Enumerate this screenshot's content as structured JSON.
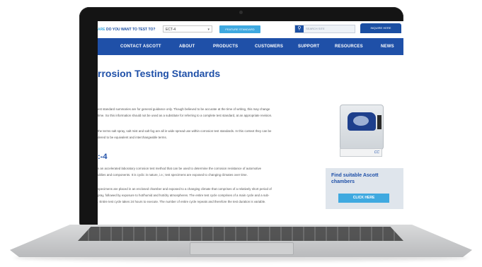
{
  "topbar": {
    "question_prefix": "ARE",
    "question_label": "DO YOU WANT TO TEST TO?",
    "select_value": "ECT-4",
    "standard_button": "FEATURE STANDARD",
    "search_placeholder": "SEARCH SITE",
    "quote_button": "INQUIRE HERE"
  },
  "nav": {
    "items": [
      "CONTACT ASCOTT",
      "ABOUT",
      "PRODUCTS",
      "CUSTOMERS",
      "SUPPORT",
      "RESOURCES",
      "NEWS"
    ]
  },
  "content": {
    "title": "rrosion Testing Standards",
    "para1_line1": "est standard summaries are for general guidance only. Though believed to be accurate at the time of writing, this may change",
    "para1_line2": "time. So this information should not be used as a substitute for referring to a complete test standard, at an appropriate revision.",
    "para2_line1": "the terms salt spray, salt mist and salt fog are all in wide spread use within corrosion test standards. In this context they can be",
    "para2_line2": "dered to be equivalent and interchangeable terms.",
    "heading2": ":-4",
    "para3_line1": "s an accelerated laboratory corrosion test method that can be used to determine the corrosion resistance of automotive",
    "para3_line2": "ublies and components. It is cyclic in nature, i.e.; test specimens are exposed to changing climates over time.",
    "para4_line1": "specimens are placed in an enclosed chamber and exposed to a changing climate that comprises of a relatively short period of",
    "para4_line2": "pray, followed by exposure to hot/humid and hot/dry atmospheres. The entire test cycle comprises of a main cycle and a sub-",
    "para4_line3": ". Entire test cycle takes 24 hours to execute. The number of entire cycle repeats and therefore the test duration is variable."
  },
  "product": {
    "foot_label": "CC"
  },
  "sidebar": {
    "title": "Find suitable Ascott chambers",
    "button": "CLICK HERE"
  },
  "colors": {
    "brand_blue": "#1f50a8",
    "accent_blue": "#3fa9e0"
  }
}
